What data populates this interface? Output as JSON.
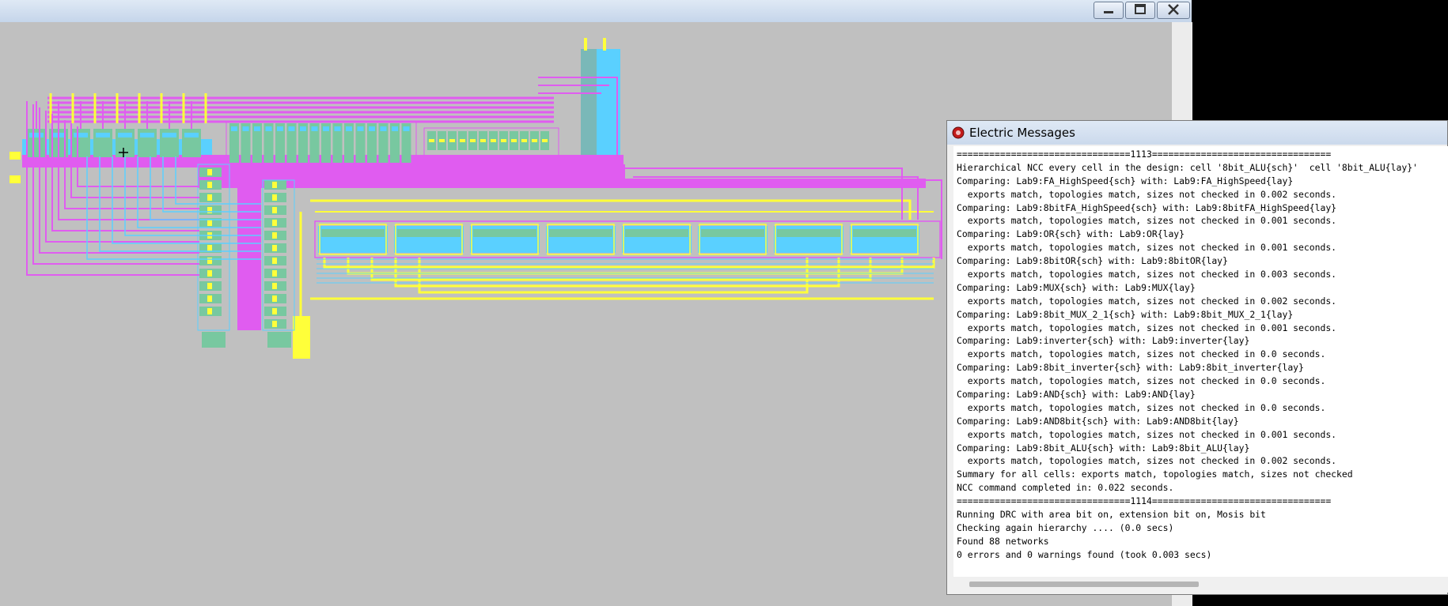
{
  "window": {
    "minimize_icon": "minimize-icon",
    "maximize_icon": "maximize-icon",
    "close_icon": "close-icon"
  },
  "layout_view": {
    "description_colors": {
      "metal1": "#5ad0ff",
      "metal2": "#e05cf0",
      "poly": "#ffff3a",
      "diffusion": "#78c8a0",
      "background": "#c0c0c0"
    }
  },
  "messages": {
    "title": "Electric Messages",
    "lines": [
      "================================1113=================================",
      "Hierarchical NCC every cell in the design: cell '8bit_ALU{sch}'  cell '8bit_ALU{lay}'",
      "Comparing: Lab9:FA_HighSpeed{sch} with: Lab9:FA_HighSpeed{lay}",
      "  exports match, topologies match, sizes not checked in 0.002 seconds.",
      "Comparing: Lab9:8bitFA_HighSpeed{sch} with: Lab9:8bitFA_HighSpeed{lay}",
      "  exports match, topologies match, sizes not checked in 0.001 seconds.",
      "Comparing: Lab9:OR{sch} with: Lab9:OR{lay}",
      "  exports match, topologies match, sizes not checked in 0.001 seconds.",
      "Comparing: Lab9:8bitOR{sch} with: Lab9:8bitOR{lay}",
      "  exports match, topologies match, sizes not checked in 0.003 seconds.",
      "Comparing: Lab9:MUX{sch} with: Lab9:MUX{lay}",
      "  exports match, topologies match, sizes not checked in 0.002 seconds.",
      "Comparing: Lab9:8bit_MUX_2_1{sch} with: Lab9:8bit_MUX_2_1{lay}",
      "  exports match, topologies match, sizes not checked in 0.001 seconds.",
      "Comparing: Lab9:inverter{sch} with: Lab9:inverter{lay}",
      "  exports match, topologies match, sizes not checked in 0.0 seconds.",
      "Comparing: Lab9:8bit_inverter{sch} with: Lab9:8bit_inverter{lay}",
      "  exports match, topologies match, sizes not checked in 0.0 seconds.",
      "Comparing: Lab9:AND{sch} with: Lab9:AND{lay}",
      "  exports match, topologies match, sizes not checked in 0.0 seconds.",
      "Comparing: Lab9:AND8bit{sch} with: Lab9:AND8bit{lay}",
      "  exports match, topologies match, sizes not checked in 0.001 seconds.",
      "Comparing: Lab9:8bit_ALU{sch} with: Lab9:8bit_ALU{lay}",
      "  exports match, topologies match, sizes not checked in 0.002 seconds.",
      "Summary for all cells: exports match, topologies match, sizes not checked",
      "NCC command completed in: 0.022 seconds.",
      "================================1114=================================",
      "Running DRC with area bit on, extension bit on, Mosis bit",
      "Checking again hierarchy .... (0.0 secs)",
      "Found 88 networks",
      "0 errors and 0 warnings found (took 0.003 secs)"
    ]
  }
}
